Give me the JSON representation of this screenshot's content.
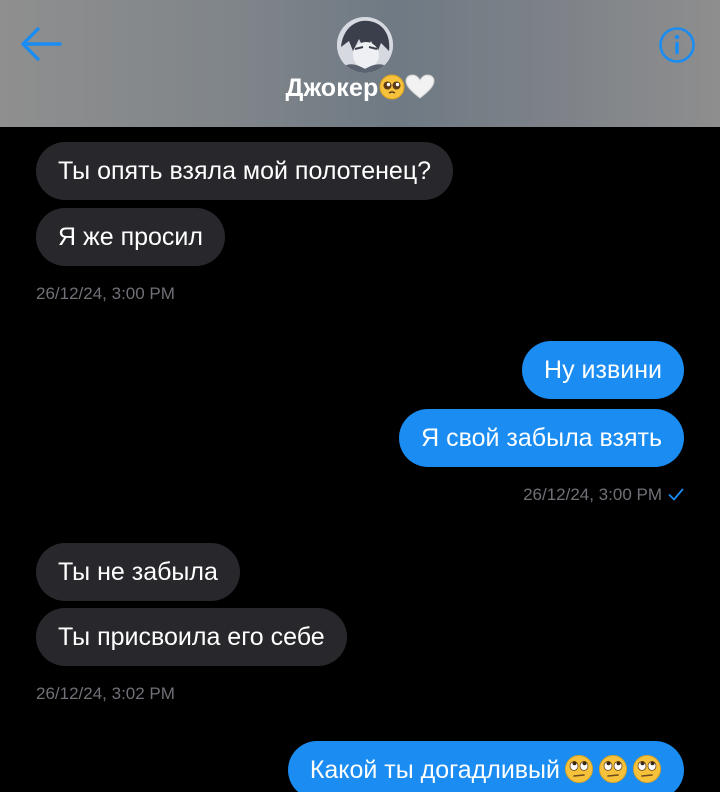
{
  "header": {
    "contact_name": "Джокер",
    "name_emojis": [
      "pleading-face-emoji",
      "white-heart-emoji"
    ],
    "back_icon": "arrow-left-icon",
    "info_icon": "info-circle-icon",
    "accent_color": "#1a8cf2"
  },
  "messages": [
    {
      "side": "incoming",
      "text": "Ты опять взяла мой полотенец?"
    },
    {
      "side": "incoming",
      "text": "Я же просил"
    },
    {
      "side": "incoming-timestamp",
      "text": "26/12/24, 3:00 PM"
    },
    {
      "side": "outgoing",
      "text": "Ну извини"
    },
    {
      "side": "outgoing",
      "text": "Я свой забыла взять"
    },
    {
      "side": "outgoing-timestamp",
      "text": "26/12/24, 3:00 PM",
      "status": "sent-check-icon"
    },
    {
      "side": "incoming",
      "text": "Ты не забыла"
    },
    {
      "side": "incoming",
      "text": "Ты присвоила его себе"
    },
    {
      "side": "incoming-timestamp",
      "text": "26/12/24, 3:02 PM"
    },
    {
      "side": "outgoing",
      "text": "Какой ты догадливый",
      "emojis": [
        "eye-roll-emoji",
        "eye-roll-emoji",
        "eye-roll-emoji"
      ]
    }
  ],
  "colors": {
    "incoming_bubble": "#28272c",
    "outgoing_bubble": "#1a8cf2",
    "timestamp": "#707077",
    "background": "#000000"
  }
}
